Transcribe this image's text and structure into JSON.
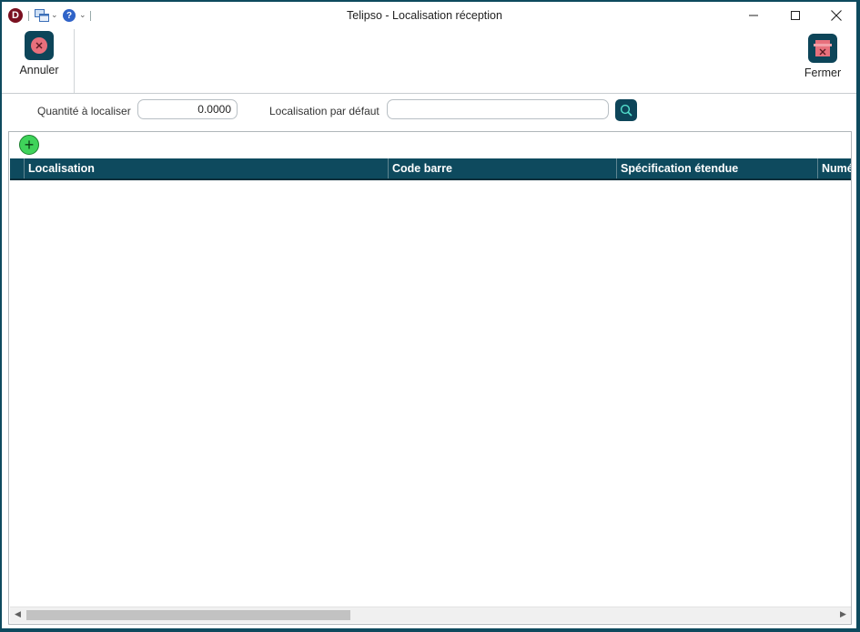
{
  "window": {
    "title": "Telipso - Localisation réception",
    "logo_letter": "D"
  },
  "toolbar": {
    "cancel_label": "Annuler",
    "close_label": "Fermer"
  },
  "form": {
    "quantity_label": "Quantité à localiser",
    "quantity_value": "0.0000",
    "default_location_label": "Localisation par défaut",
    "default_location_value": ""
  },
  "grid": {
    "columns": [
      "Localisation",
      "Code barre",
      "Spécification étendue",
      "Numé"
    ],
    "rows": []
  },
  "icons": {
    "app": "app-logo-icon",
    "windows": "windows-icon",
    "help": "help-icon",
    "cancel": "cancel-icon",
    "close": "close-form-icon",
    "search": "search-icon",
    "add": "add-icon"
  },
  "colors": {
    "accent": "#0e4a5e",
    "cancel_icon": "#e8707c",
    "add_button": "#3fd35a"
  }
}
